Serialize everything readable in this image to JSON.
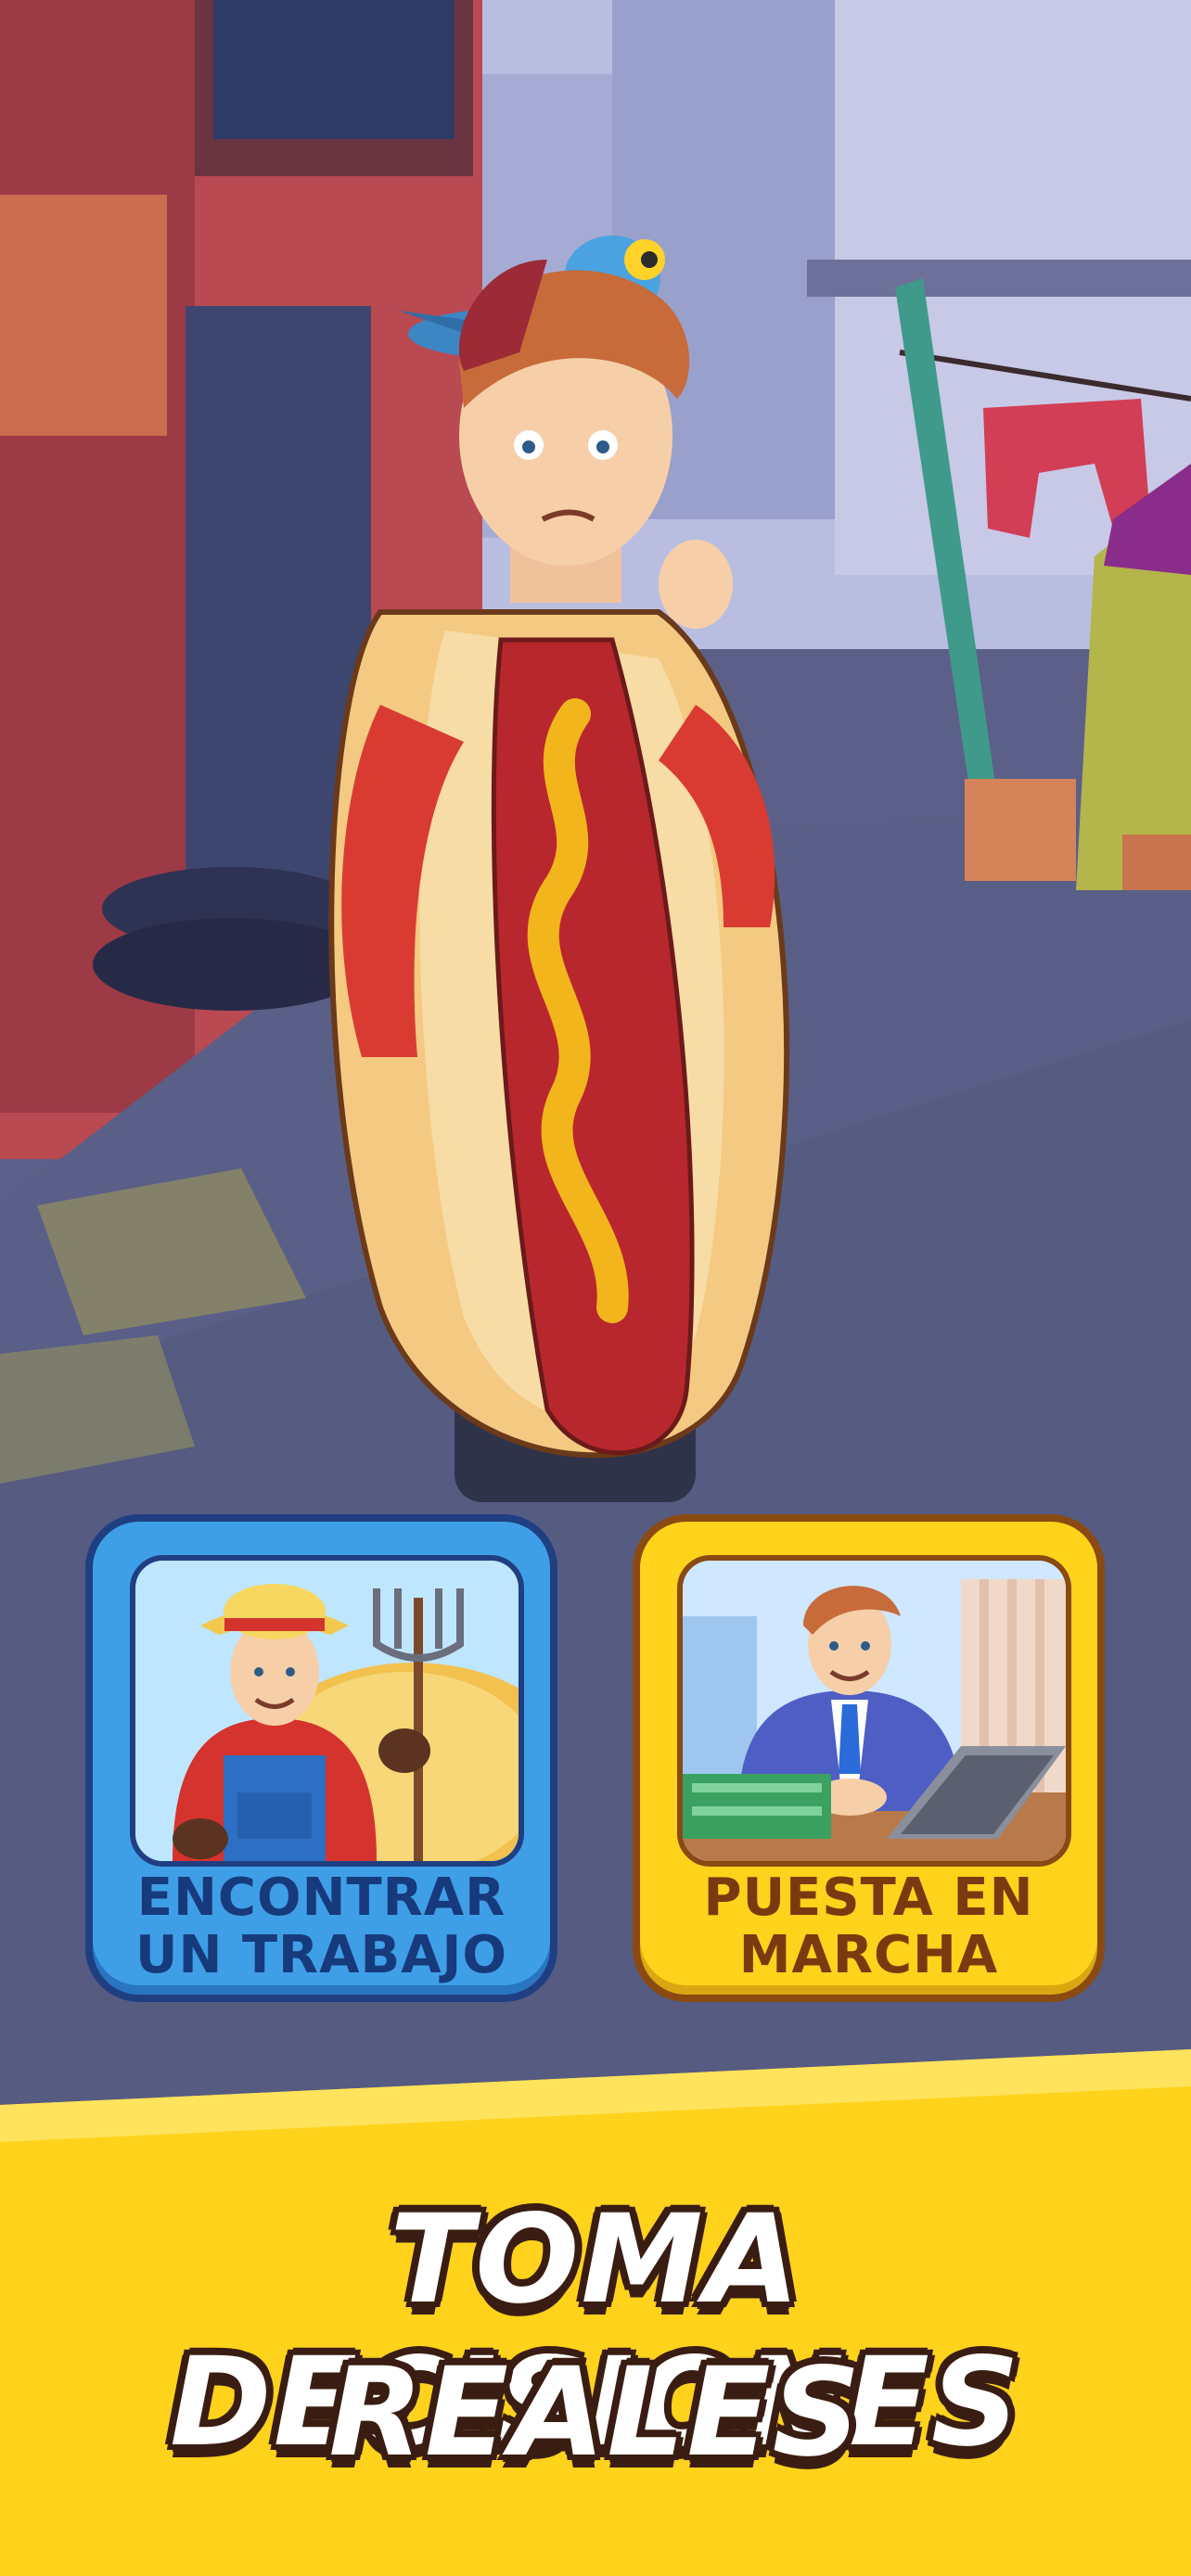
{
  "choices": [
    {
      "label_line1": "ENCONTRAR",
      "label_line2": "UN TRABAJO",
      "color": "#3f9fe6"
    },
    {
      "label_line1": "PUESTA EN",
      "label_line2": "MARCHA",
      "color": "#ffd21c"
    }
  ],
  "headline": {
    "line1": "TOMA DECISIONES",
    "line2": "REALES",
    "color": "#ffffff"
  },
  "banner_color": "#ffd21c"
}
